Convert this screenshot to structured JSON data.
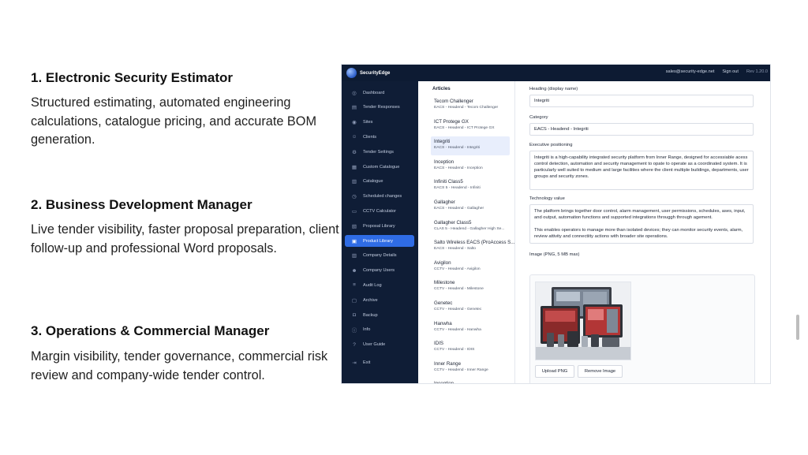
{
  "sections": [
    {
      "title": "1. Electronic Security Estimator",
      "desc": "Structured estimating, automated engineering calculations, catalogue pricing, and accurate BOM generation."
    },
    {
      "title": "2. Business Development Manager",
      "desc": "Live tender visibility, faster proposal preparation, client follow-up and professional Word proposals."
    },
    {
      "title": "3. Operations & Commercial Manager",
      "desc": "Margin visibility, tender governance, commercial risk review and company-wide tender control."
    }
  ],
  "app": {
    "brand": "SecurityEdge",
    "email": "sales@security-edge.net",
    "signout": "Sign out",
    "version": "Rev 1.20.0",
    "nav": [
      {
        "label": "Dashboard",
        "icon": "dashboard-icon"
      },
      {
        "label": "Tender Responses",
        "icon": "document-icon"
      },
      {
        "label": "Sites",
        "icon": "location-icon"
      },
      {
        "label": "Clients",
        "icon": "user-icon"
      },
      {
        "label": "Tender Settings",
        "icon": "settings-icon"
      },
      {
        "label": "Custom Catalogue",
        "icon": "catalogue-icon"
      },
      {
        "label": "Catalogue",
        "icon": "book-icon"
      },
      {
        "label": "Scheduled changes",
        "icon": "clock-icon"
      },
      {
        "label": "CCTV Calculator",
        "icon": "camera-icon"
      },
      {
        "label": "Proposal Library",
        "icon": "library-icon"
      },
      {
        "label": "Product Library",
        "icon": "box-icon"
      },
      {
        "label": "Company Details",
        "icon": "building-icon"
      },
      {
        "label": "Company Users",
        "icon": "users-icon"
      },
      {
        "label": "Audit Log",
        "icon": "list-icon"
      },
      {
        "label": "Archive",
        "icon": "archive-icon"
      },
      {
        "label": "Backup",
        "icon": "backup-icon"
      },
      {
        "label": "Info",
        "icon": "info-icon"
      },
      {
        "label": "User Guide",
        "icon": "guide-icon"
      },
      {
        "label": "Exit",
        "icon": "exit-icon"
      }
    ],
    "active_nav": "Product Library",
    "articles_heading": "Articles",
    "articles": [
      {
        "name": "Tecom Challenger",
        "sub": "EACS - Headend - Tecom Challenger"
      },
      {
        "name": "ICT Protege GX",
        "sub": "EACS - Headend - ICT Protege GX"
      },
      {
        "name": "Integriti",
        "sub": "EACS - Headend - Integriti"
      },
      {
        "name": "Inception",
        "sub": "EACS - Headend - Inception"
      },
      {
        "name": "Infiniti Class5",
        "sub": "EACS 5 - Headend - Infiniti"
      },
      {
        "name": "Gallagher",
        "sub": "EACS - Headend - Gallagher"
      },
      {
        "name": "Gallagher Class5",
        "sub": "CLAS 5 - Headend - Gallagher High Se..."
      },
      {
        "name": "Salto Wireless EACS (ProAccess S...",
        "sub": "EACS - Headend - Salto"
      },
      {
        "name": "Avigilon",
        "sub": "CCTV - Headend - Avigilon"
      },
      {
        "name": "Milestone",
        "sub": "CCTV - Headend - Milestone"
      },
      {
        "name": "Genetec",
        "sub": "CCTV - Headend - Genetec"
      },
      {
        "name": "Hanwha",
        "sub": "CCTV - Headend - Hanwha"
      },
      {
        "name": "IDIS",
        "sub": "CCTV - Headend - IDIS"
      },
      {
        "name": "Inner Range",
        "sub": "CCTV - Headend - Inner Range"
      },
      {
        "name": "Inception",
        "sub": ""
      }
    ],
    "active_article": 2,
    "detail": {
      "heading_label": "Heading (display name)",
      "heading_value": "Integriti",
      "category_label": "Category",
      "category_value": "EACS - Headend - Integriti",
      "exec_label": "Executive positioning",
      "exec_value": "Integriti is a high-capability integrated security platform from Inner Range, designed for accessiable acess control detection, automation and security management to opate to operate as a coordinated system. It is particularly well suited to medium and large facilities where the client multiple buildings, departments, user groups and security zones.",
      "tech_label": "Technology value",
      "tech_value_1": "The platform brings together door control, alarm management, user permissions, schedules, ases, input, and output, automation functions and supported integrations througgh through agement.",
      "tech_value_2": "This enables operators to manage more than isolated devices; they can monitor security events, alarm, review attivity and connectiity actions with broader site operations.",
      "image_label": "Image (PNG, 5 MB max)",
      "upload_label": "Upload PNG",
      "remove_label": "Remove Image"
    }
  }
}
